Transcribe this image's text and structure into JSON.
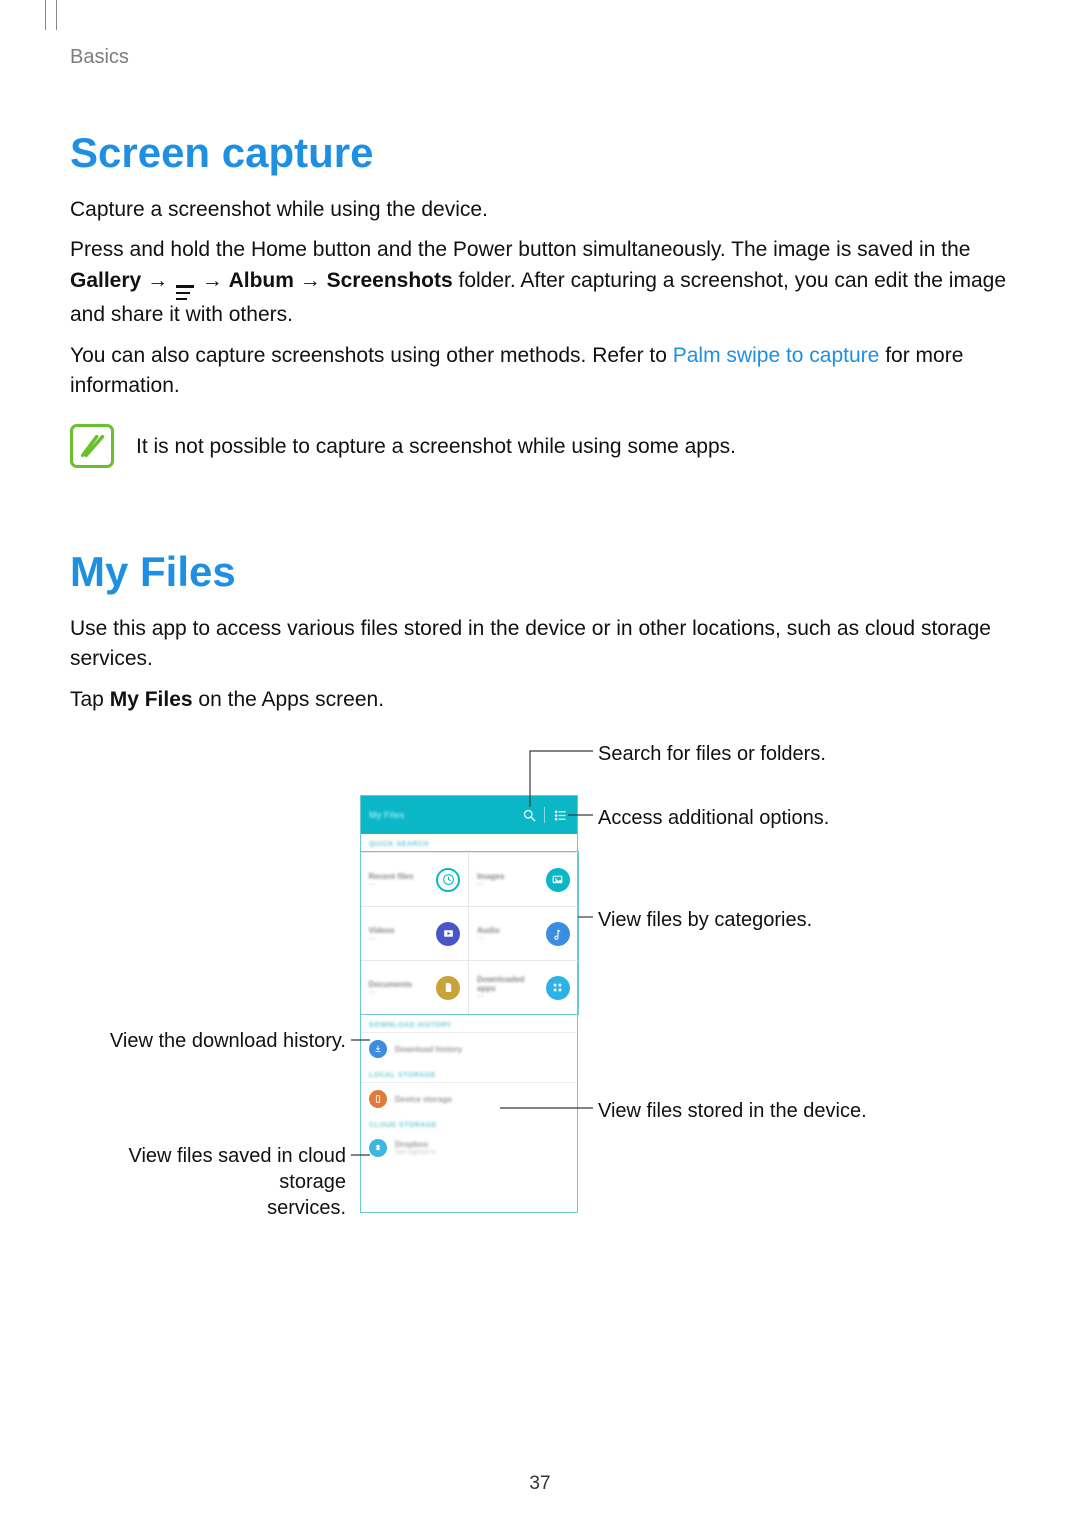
{
  "breadcrumb": "Basics",
  "section1": {
    "heading": "Screen capture",
    "p1": "Capture a screenshot while using the device.",
    "p2a": "Press and hold the Home button and the Power button simultaneously. The image is saved in the ",
    "gallery": "Gallery",
    "arrow": "→",
    "album": "Album",
    "screenshots": "Screenshots",
    "p2b": " folder. After capturing a screenshot, you can edit the image and share it with others.",
    "p3a": "You can also capture screenshots using other methods. Refer to ",
    "link": "Palm swipe to capture",
    "p3b": " for more information.",
    "note": "It is not possible to capture a screenshot while using some apps."
  },
  "section2": {
    "heading": "My Files",
    "p1": "Use this app to access various files stored in the device or in other locations, such as cloud storage services.",
    "p2a": "Tap ",
    "myfiles": "My Files",
    "p2b": " on the Apps screen."
  },
  "phone": {
    "title": "My Files",
    "quick_search": "QUICK SEARCH",
    "tiles": {
      "recent": "Recent files",
      "images": "Images",
      "videos": "Videos",
      "audio": "Audio",
      "documents": "Documents",
      "downloaded": "Downloaded apps"
    },
    "download_history_label": "DOWNLOAD HISTORY",
    "download_history_item": "Download history",
    "local_storage_label": "LOCAL STORAGE",
    "device_storage_item": "Device storage",
    "cloud_storage_label": "CLOUD STORAGE",
    "dropbox_item": "Dropbox",
    "dropbox_sub": "Not signed in"
  },
  "callouts": {
    "search": "Search for files or folders.",
    "options": "Access additional options.",
    "categories": "View files by categories.",
    "download": "View the download history.",
    "device": "View files stored in the device.",
    "cloud_l1": "View files saved in cloud storage",
    "cloud_l2": "services."
  },
  "page_number": "37"
}
